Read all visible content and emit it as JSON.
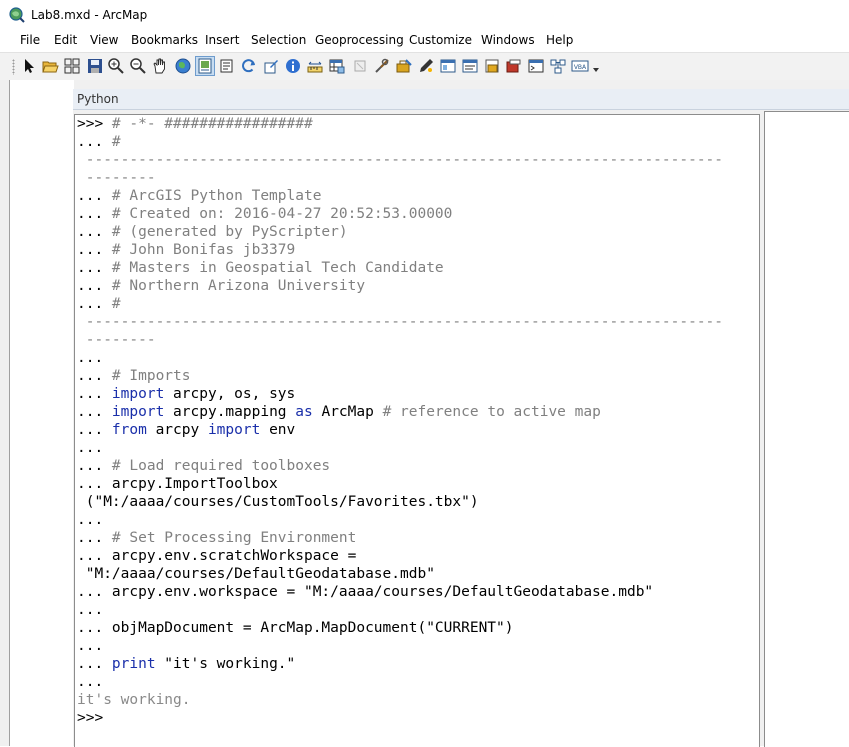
{
  "window": {
    "title": "Lab8.mxd - ArcMap",
    "icon": "arcmap-globe-icon"
  },
  "menu": [
    "File",
    "Edit",
    "View",
    "Bookmarks",
    "Insert",
    "Selection",
    "Geoprocessing",
    "Customize",
    "Windows",
    "Help"
  ],
  "toolbar": {
    "buttons": [
      "select-elements-icon",
      "open-icon",
      "select-features-grid-icon",
      "save-icon",
      "zoom-in-icon",
      "zoom-out-icon",
      "pan-hand-icon",
      "full-extent-globe-icon",
      "identify-icon",
      "layout-icon",
      "refresh-icon",
      "editor-icon",
      "info-icon",
      "measure-icon",
      "table-icon",
      "select-by-graphic-icon",
      "tools-icon",
      "arctoolbox-icon",
      "editor-pencil-icon",
      "catalog-icon",
      "search-window-icon",
      "toolbox-icon",
      "model-builder-icon",
      "python-window-icon",
      "diagram-icon",
      "vba-icon"
    ],
    "pressed": "layout-icon",
    "overflow_icon": "toolbar-overflow-chevron-icon"
  },
  "python_window": {
    "title": "Python",
    "console_lines": [
      [
        [
          "t",
          ">>> "
        ],
        [
          "c",
          "# -*- #################"
        ]
      ],
      [
        [
          "t",
          "... "
        ],
        [
          "c",
          "#"
        ]
      ],
      [
        [
          "t",
          " "
        ],
        [
          "c",
          "-------------------------------------------------------------------------"
        ]
      ],
      [
        [
          "t",
          " "
        ],
        [
          "c",
          "--------"
        ]
      ],
      [
        [
          "t",
          "... "
        ],
        [
          "c",
          "# ArcGIS Python Template"
        ]
      ],
      [
        [
          "t",
          "... "
        ],
        [
          "c",
          "# Created on: 2016-04-27 20:52:53.00000"
        ]
      ],
      [
        [
          "t",
          "... "
        ],
        [
          "c",
          "# (generated by PyScripter)"
        ]
      ],
      [
        [
          "t",
          "... "
        ],
        [
          "c",
          "# John Bonifas jb3379"
        ]
      ],
      [
        [
          "t",
          "... "
        ],
        [
          "c",
          "# Masters in Geospatial Tech Candidate"
        ]
      ],
      [
        [
          "t",
          "... "
        ],
        [
          "c",
          "# Northern Arizona University"
        ]
      ],
      [
        [
          "t",
          "... "
        ],
        [
          "c",
          "#"
        ]
      ],
      [
        [
          "t",
          " "
        ],
        [
          "c",
          "-------------------------------------------------------------------------"
        ]
      ],
      [
        [
          "t",
          " "
        ],
        [
          "c",
          "--------"
        ]
      ],
      [
        [
          "t",
          "..."
        ]
      ],
      [
        [
          "t",
          "... "
        ],
        [
          "c",
          "# Imports"
        ]
      ],
      [
        [
          "t",
          "... "
        ],
        [
          "k",
          "import"
        ],
        [
          "t",
          " arcpy, os, sys"
        ]
      ],
      [
        [
          "t",
          "... "
        ],
        [
          "k",
          "import"
        ],
        [
          "t",
          " arcpy.mapping "
        ],
        [
          "k",
          "as"
        ],
        [
          "t",
          " ArcMap "
        ],
        [
          "c",
          "# reference to active map"
        ]
      ],
      [
        [
          "t",
          "... "
        ],
        [
          "k",
          "from"
        ],
        [
          "t",
          " arcpy "
        ],
        [
          "k",
          "import"
        ],
        [
          "t",
          " env"
        ]
      ],
      [
        [
          "t",
          "..."
        ]
      ],
      [
        [
          "t",
          "... "
        ],
        [
          "c",
          "# Load required toolboxes"
        ]
      ],
      [
        [
          "t",
          "... arcpy.ImportToolbox"
        ]
      ],
      [
        [
          "t",
          " (\"M:/aaaa/courses/CustomTools/Favorites.tbx\")"
        ]
      ],
      [
        [
          "t",
          "..."
        ]
      ],
      [
        [
          "t",
          "... "
        ],
        [
          "c",
          "# Set Processing Environment"
        ]
      ],
      [
        [
          "t",
          "... arcpy.env.scratchWorkspace ="
        ]
      ],
      [
        [
          "t",
          " \"M:/aaaa/courses/DefaultGeodatabase.mdb\""
        ]
      ],
      [
        [
          "t",
          "... arcpy.env.workspace = \"M:/aaaa/courses/DefaultGeodatabase.mdb\""
        ]
      ],
      [
        [
          "t",
          "..."
        ]
      ],
      [
        [
          "t",
          "... objMapDocument = ArcMap.MapDocument(\"CURRENT\")"
        ]
      ],
      [
        [
          "t",
          "..."
        ]
      ],
      [
        [
          "t",
          "... "
        ],
        [
          "k",
          "print"
        ],
        [
          "t",
          " \"it's working.\""
        ]
      ],
      [
        [
          "t",
          "..."
        ]
      ],
      [
        [
          "o",
          "it's working."
        ]
      ],
      [
        [
          "t",
          ">>>"
        ]
      ]
    ],
    "colors": {
      "comment": "#808080",
      "keyword": "#1a2faa",
      "output": "#8a8a8a"
    }
  }
}
